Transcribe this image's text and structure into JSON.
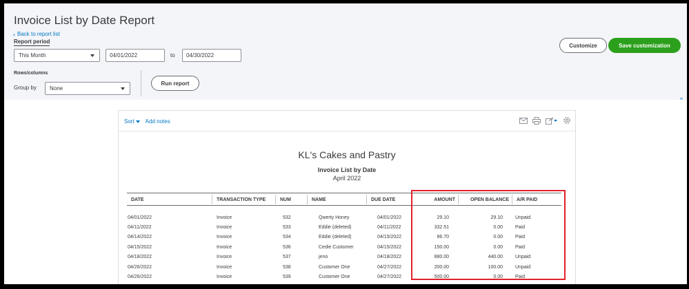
{
  "header": {
    "title": "Invoice List by Date Report",
    "back_link": "Back to report list",
    "report_period_label": "Report period",
    "period_select": "This Month",
    "date_from": "04/01/2022",
    "to_label": "to",
    "date_to": "04/30/2022",
    "rows_columns_label": "Rows/columns",
    "group_by_label": "Group by",
    "group_by_select": "None",
    "run_report": "Run report",
    "customize": "Customize",
    "save_customization": "Save customization"
  },
  "toolbar": {
    "sort": "Sort",
    "add_notes": "Add notes",
    "icons": [
      "mail-icon",
      "print-icon",
      "export-icon",
      "settings-icon"
    ]
  },
  "report": {
    "company": "KL's Cakes and Pastry",
    "name": "Invoice List by Date",
    "date": "April 2022",
    "columns": [
      "DATE",
      "TRANSACTION TYPE",
      "NUM",
      "NAME",
      "DUE DATE",
      "AMOUNT",
      "OPEN BALANCE",
      "A/R PAID"
    ],
    "rows": [
      [
        "04/01/2022",
        "Invoice",
        "532",
        "Qwerty Honey",
        "04/01/2022",
        "29.10",
        "29.10",
        "Unpaid"
      ],
      [
        "04/11/2022",
        "Invoice",
        "533",
        "Eddie (deleted)",
        "04/11/2022",
        "332.51",
        "0.00",
        "Paid"
      ],
      [
        "04/14/2022",
        "Invoice",
        "534",
        "Eddie (deleted)",
        "04/15/2022",
        "86.70",
        "0.00",
        "Paid"
      ],
      [
        "04/15/2022",
        "Invoice",
        "536",
        "Cedie Customer",
        "04/15/2022",
        "150.00",
        "0.00",
        "Paid"
      ],
      [
        "04/18/2022",
        "Invoice",
        "537",
        "jeno",
        "04/18/2022",
        "880.00",
        "440.00",
        "Unpaid"
      ],
      [
        "04/26/2022",
        "Invoice",
        "538",
        "Customer One",
        "04/27/2022",
        "200.00",
        "100.00",
        "Unpaid"
      ],
      [
        "04/26/2022",
        "Invoice",
        "539",
        "Customer One",
        "04/27/2022",
        "500.00",
        "0.00",
        "Paid"
      ]
    ]
  },
  "colors": {
    "accent_green": "#2ca01c",
    "link_blue": "#0077c5",
    "highlight_red": "#e2202a"
  }
}
